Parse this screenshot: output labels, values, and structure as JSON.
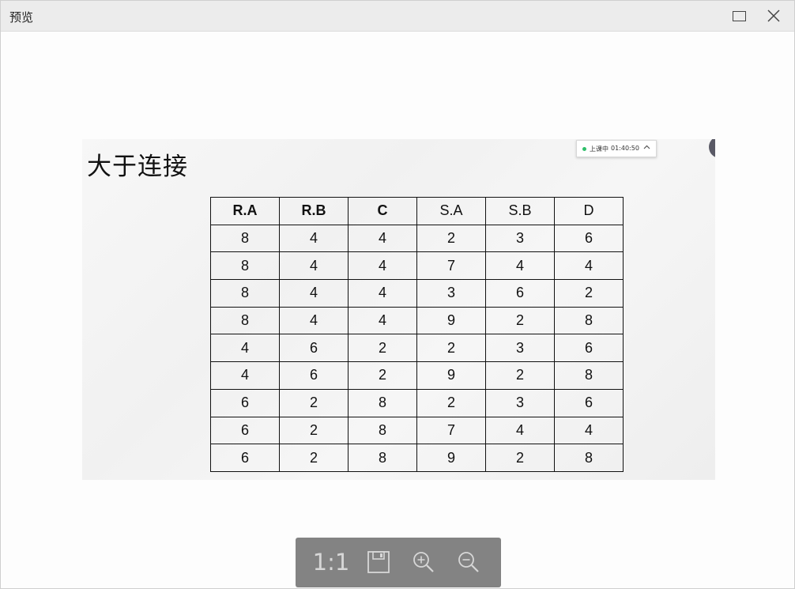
{
  "window": {
    "title": "预览"
  },
  "slide": {
    "title": "大于连接",
    "class_widget": {
      "status": "上课中",
      "time": "01:40:50"
    }
  },
  "table": {
    "headers": [
      {
        "label": "R.A",
        "bold": true
      },
      {
        "label": "R.B",
        "bold": true
      },
      {
        "label": "C",
        "bold": true
      },
      {
        "label": "S.A",
        "bold": false
      },
      {
        "label": "S.B",
        "bold": false
      },
      {
        "label": "D",
        "bold": false
      }
    ],
    "rows": [
      [
        "8",
        "4",
        "4",
        "2",
        "3",
        "6"
      ],
      [
        "8",
        "4",
        "4",
        "7",
        "4",
        "4"
      ],
      [
        "8",
        "4",
        "4",
        "3",
        "6",
        "2"
      ],
      [
        "8",
        "4",
        "4",
        "9",
        "2",
        "8"
      ],
      [
        "4",
        "6",
        "2",
        "2",
        "3",
        "6"
      ],
      [
        "4",
        "6",
        "2",
        "9",
        "2",
        "8"
      ],
      [
        "6",
        "2",
        "8",
        "2",
        "3",
        "6"
      ],
      [
        "6",
        "2",
        "8",
        "7",
        "4",
        "4"
      ],
      [
        "6",
        "2",
        "8",
        "9",
        "2",
        "8"
      ]
    ]
  },
  "toolbar": {
    "ratio_label": "1:1",
    "icons": [
      "save-icon",
      "zoom-in-icon",
      "zoom-out-icon"
    ]
  },
  "colors": {
    "toolbar_bg": "#838383",
    "titlebar_bg": "#ececec",
    "live_dot": "#2fbf6a"
  }
}
